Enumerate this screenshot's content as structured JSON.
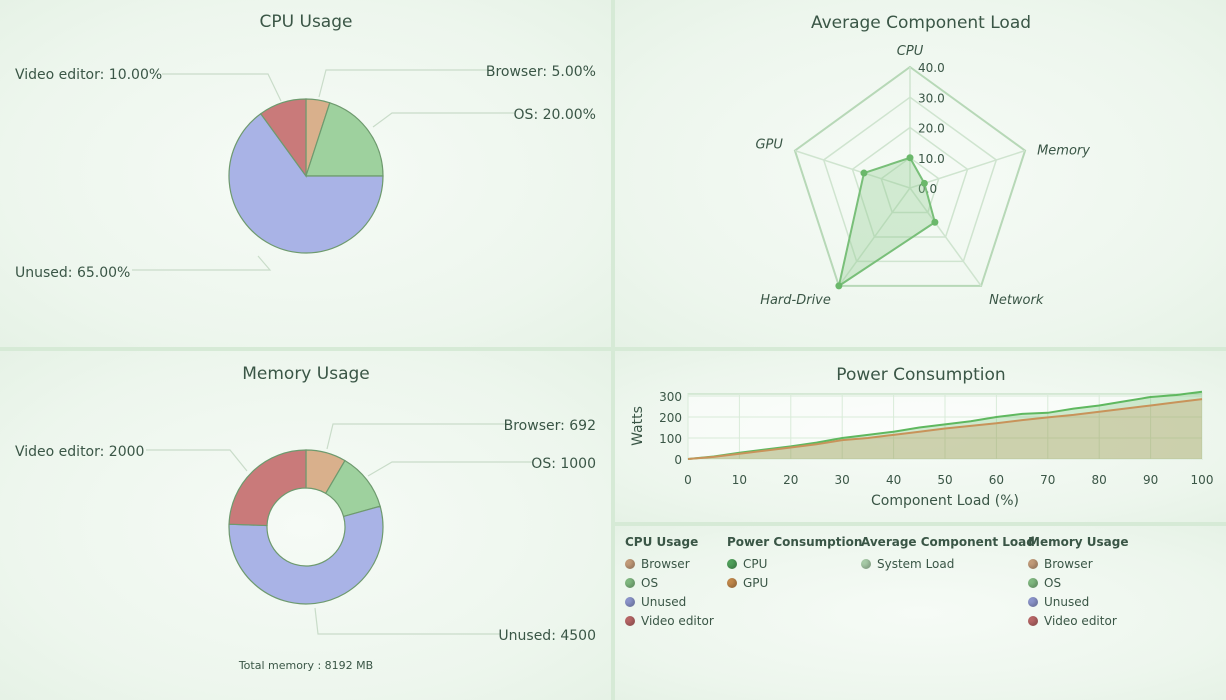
{
  "chart_data": [
    {
      "type": "pie",
      "title": "CPU Usage",
      "slices": [
        {
          "name": "Browser",
          "value": 5,
          "label": "Browser: 5.00%",
          "color": "#d9b08c"
        },
        {
          "name": "OS",
          "value": 20,
          "label": "OS: 20.00%",
          "color": "#9ed19e"
        },
        {
          "name": "Unused",
          "value": 65,
          "label": "Unused: 65.00%",
          "color": "#a9b3e6"
        },
        {
          "name": "Video editor",
          "value": 10,
          "label": "Video editor: 10.00%",
          "color": "#c97a7a"
        }
      ]
    },
    {
      "type": "radar",
      "title": "Average Component Load",
      "axes": [
        "CPU",
        "Memory",
        "Network",
        "Hard-Drive",
        "GPU"
      ],
      "ticks": [
        "0.0",
        "10.0",
        "20.0",
        "30.0",
        "40.0"
      ],
      "range": [
        0,
        40
      ],
      "series": [
        {
          "name": "System Load",
          "values": [
            10,
            5,
            14,
            40,
            16
          ]
        }
      ]
    },
    {
      "type": "pie",
      "title": "Memory Usage",
      "donut": true,
      "footer": "Total memory : 8192 MB",
      "slices": [
        {
          "name": "Browser",
          "value": 692,
          "label": "Browser: 692",
          "color": "#d9b08c"
        },
        {
          "name": "OS",
          "value": 1000,
          "label": "OS: 1000",
          "color": "#9ed19e"
        },
        {
          "name": "Unused",
          "value": 4500,
          "label": "Unused: 4500",
          "color": "#a9b3e6"
        },
        {
          "name": "Video editor",
          "value": 2000,
          "label": "Video editor: 2000",
          "color": "#c97a7a"
        }
      ]
    },
    {
      "type": "area",
      "title": "Power Consumption",
      "xlabel": "Component Load (%)",
      "ylabel": "Watts",
      "xlim": [
        0,
        100
      ],
      "ylim": [
        0,
        300
      ],
      "xticks": [
        "0",
        "10",
        "20",
        "30",
        "40",
        "50",
        "60",
        "70",
        "80",
        "90",
        "100"
      ],
      "yticks": [
        "0",
        "100",
        "200",
        "300"
      ],
      "x": [
        0,
        5,
        10,
        15,
        20,
        25,
        30,
        35,
        40,
        45,
        50,
        55,
        60,
        65,
        70,
        75,
        80,
        85,
        90,
        95,
        100
      ],
      "series": [
        {
          "name": "CPU",
          "color": "#5fb85f",
          "values": [
            0,
            12,
            30,
            45,
            60,
            78,
            100,
            115,
            130,
            150,
            165,
            180,
            200,
            215,
            220,
            240,
            255,
            275,
            295,
            305,
            320
          ]
        },
        {
          "name": "GPU",
          "color": "#c8935a",
          "values": [
            0,
            10,
            25,
            40,
            55,
            70,
            90,
            100,
            115,
            130,
            145,
            158,
            170,
            185,
            198,
            210,
            225,
            240,
            255,
            270,
            285
          ]
        }
      ]
    }
  ],
  "legend": [
    {
      "title": "CPU Usage",
      "items": [
        {
          "label": "Browser",
          "color": "#c19a78"
        },
        {
          "label": "OS",
          "color": "#7fb77f"
        },
        {
          "label": "Unused",
          "color": "#8a93c9"
        },
        {
          "label": "Video editor",
          "color": "#b66565"
        }
      ]
    },
    {
      "title": "Power Consumption",
      "items": [
        {
          "label": "CPU",
          "color": "#4f9f5a"
        },
        {
          "label": "GPU",
          "color": "#c0874a"
        }
      ]
    },
    {
      "title": "Average Component Load",
      "items": [
        {
          "label": "System Load",
          "color": "#a6c9a6"
        }
      ]
    },
    {
      "title": "Memory Usage",
      "items": [
        {
          "label": "Browser",
          "color": "#c19a78"
        },
        {
          "label": "OS",
          "color": "#7fb77f"
        },
        {
          "label": "Unused",
          "color": "#8a93c9"
        },
        {
          "label": "Video editor",
          "color": "#b66565"
        }
      ]
    }
  ]
}
